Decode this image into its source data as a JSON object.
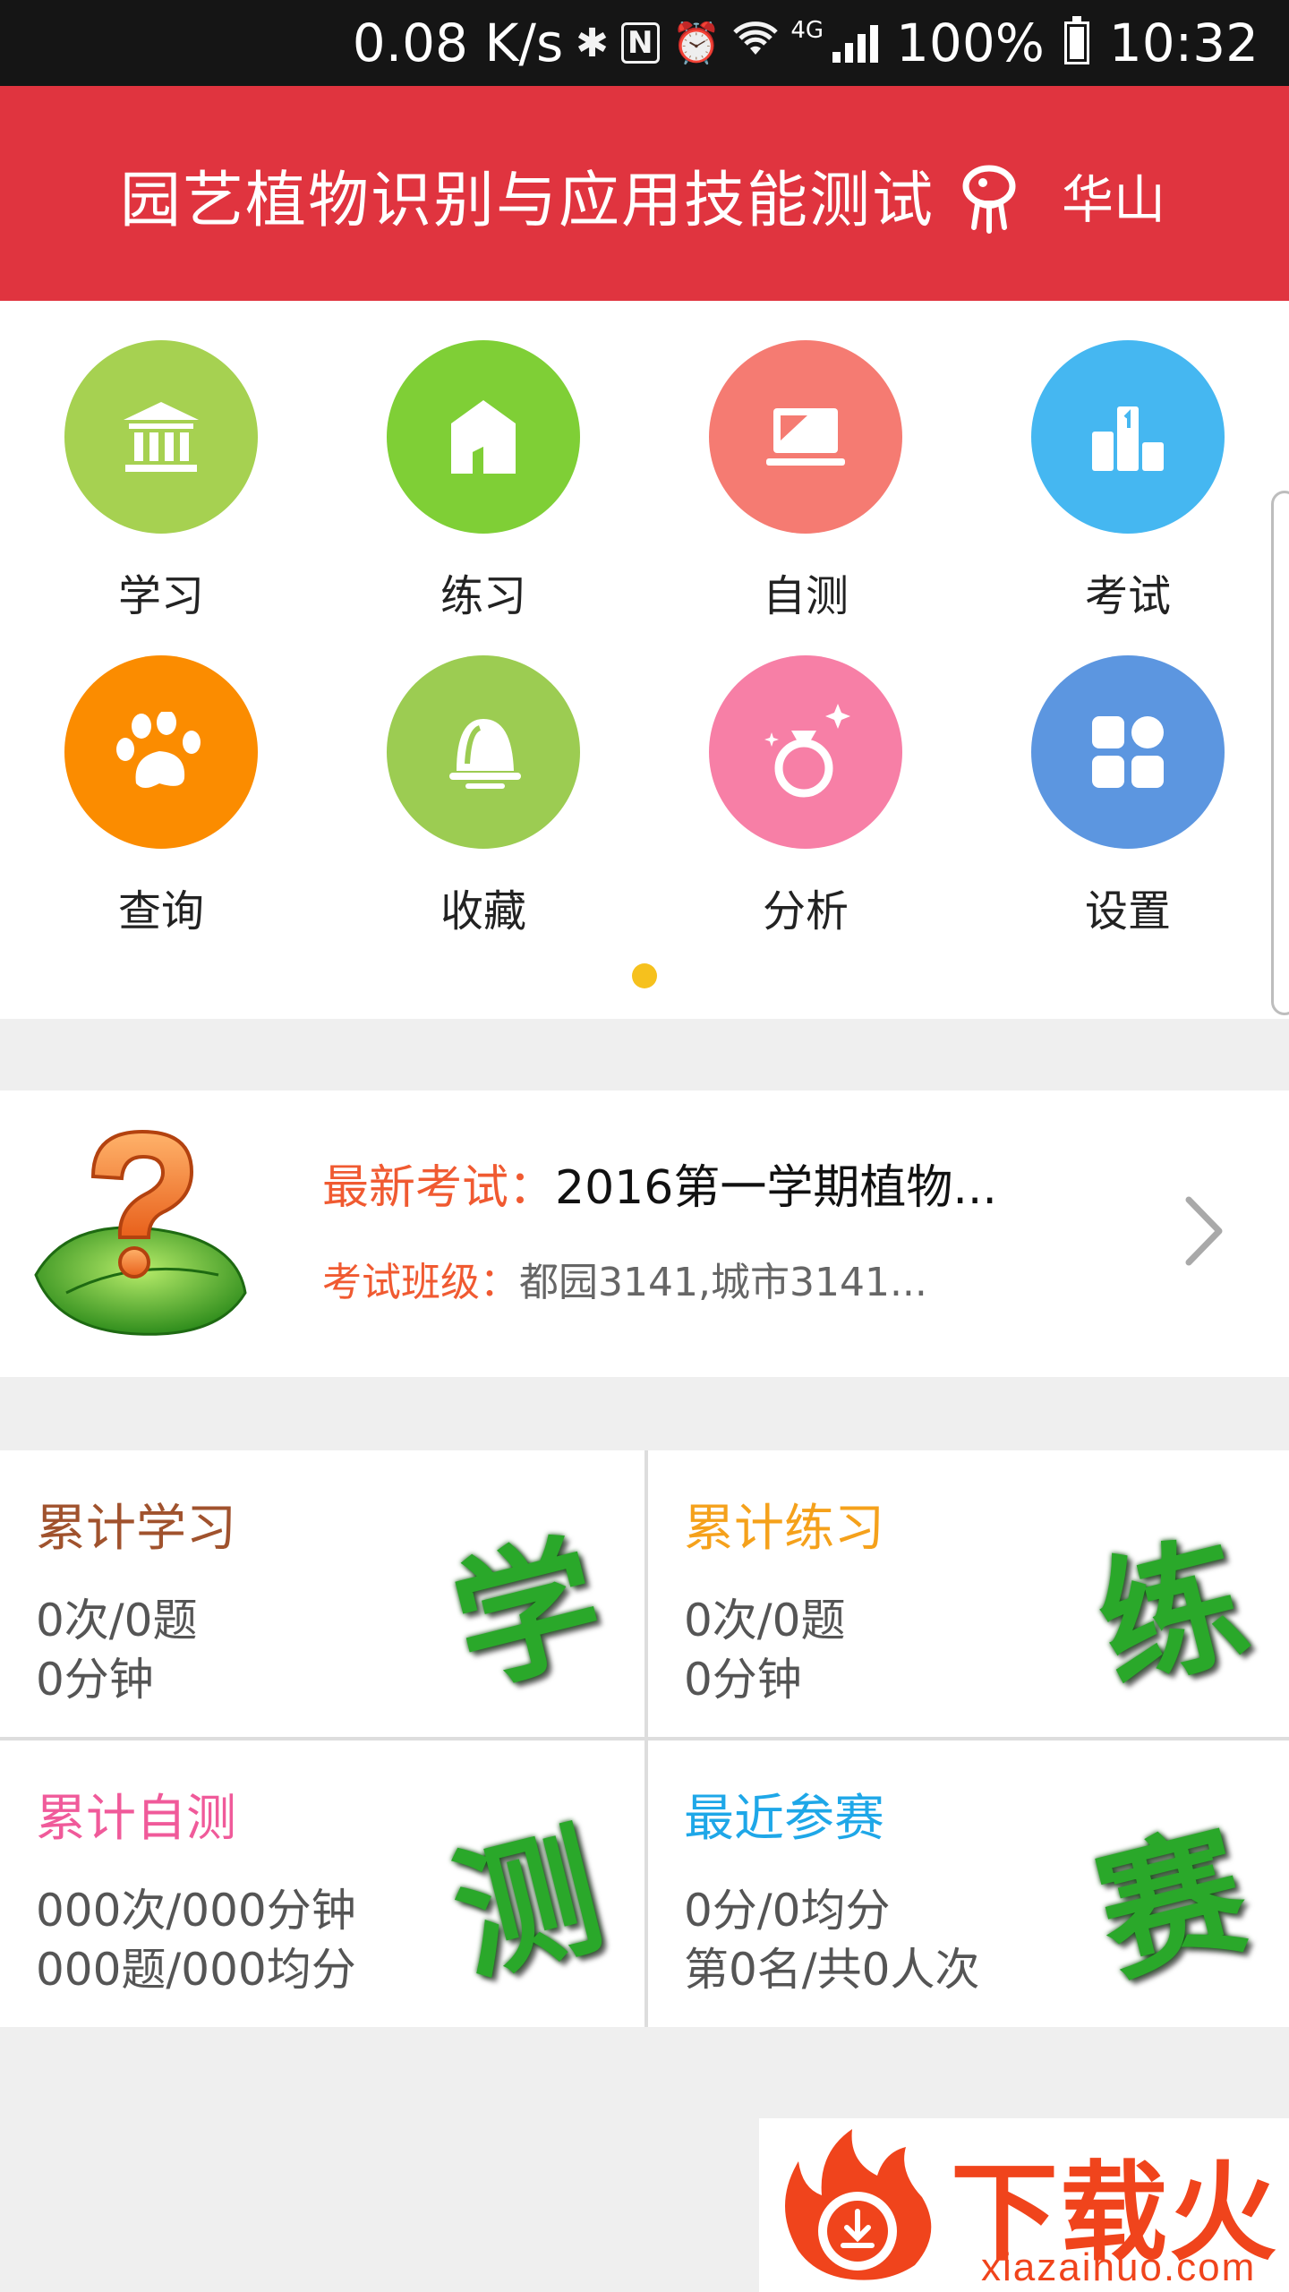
{
  "status_bar": {
    "network_speed": "0.08 K/s",
    "network_type": "4G",
    "battery": "100%",
    "time": "10:32",
    "icons": [
      "bluetooth-icon",
      "nfc-icon",
      "alarm-icon",
      "wifi-icon",
      "signal-icon",
      "battery-icon"
    ]
  },
  "header": {
    "title": "园艺植物识别与应用技能测试",
    "location_icon": "mascot-icon",
    "location": "华山"
  },
  "menu": {
    "items": [
      {
        "label": "学习",
        "icon": "museum-icon",
        "color": "#a6d151"
      },
      {
        "label": "练习",
        "icon": "house-icon",
        "color": "#7fcf36"
      },
      {
        "label": "自测",
        "icon": "laptop-icon",
        "color": "#f57b72"
      },
      {
        "label": "考试",
        "icon": "podium-icon",
        "color": "#45b7f1"
      },
      {
        "label": "查询",
        "icon": "paw-icon",
        "color": "#fb8c00"
      },
      {
        "label": "收藏",
        "icon": "bell-icon",
        "color": "#9ccc52"
      },
      {
        "label": "分析",
        "icon": "ring-icon",
        "color": "#f77fa6"
      },
      {
        "label": "设置",
        "icon": "grid-icon",
        "color": "#5c96e0"
      }
    ],
    "active_page": 1,
    "page_count": 1,
    "dot_color": "#f6c11d"
  },
  "latest_exam": {
    "exam_label": "最新考试：",
    "exam_value": "2016第一学期植物...",
    "class_label": "考试班级：",
    "class_value": "都园3141,城市3141...",
    "label_color": "#f05a31"
  },
  "stats": [
    {
      "title": "累计学习",
      "line1": "0次/0题",
      "line2": "0分钟",
      "badge": "学",
      "color": "#a0522d"
    },
    {
      "title": "累计练习",
      "line1": "0次/0题",
      "line2": "0分钟",
      "badge": "练",
      "color": "#f5a11b"
    },
    {
      "title": "累计自测",
      "line1": "000次/000分钟",
      "line2": "000题/000均分",
      "badge": "测",
      "color": "#f05a9a"
    },
    {
      "title": "最近参赛",
      "line1": "0分/0均分",
      "line2": "第0名/共0人次",
      "badge": "赛",
      "color": "#1ea7e8"
    }
  ],
  "watermark": {
    "text": "下载火",
    "url": "xiazaihuo.com"
  }
}
